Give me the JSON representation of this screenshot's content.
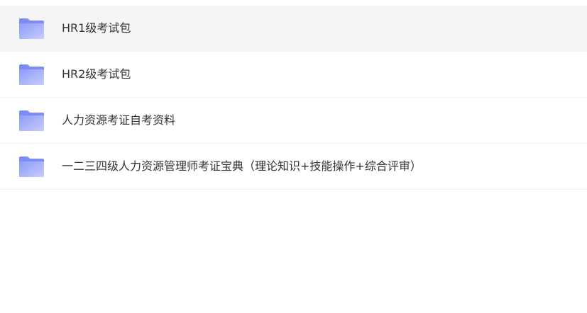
{
  "folders": [
    {
      "name": "HR1级考试包",
      "icon": "folder-icon"
    },
    {
      "name": "HR2级考试包",
      "icon": "folder-icon"
    },
    {
      "name": "人力资源考证自考资料",
      "icon": "folder-icon"
    },
    {
      "name": "一二三四级人力资源管理师考证宝典（理论知识+技能操作+综合评审）",
      "icon": "folder-icon"
    }
  ],
  "colors": {
    "folder_back": "#7c8cf2",
    "folder_front_start": "#9aa6fb",
    "folder_front_end": "#c3ccff",
    "hover_bg": "#f5f5f6",
    "text": "#333333"
  }
}
